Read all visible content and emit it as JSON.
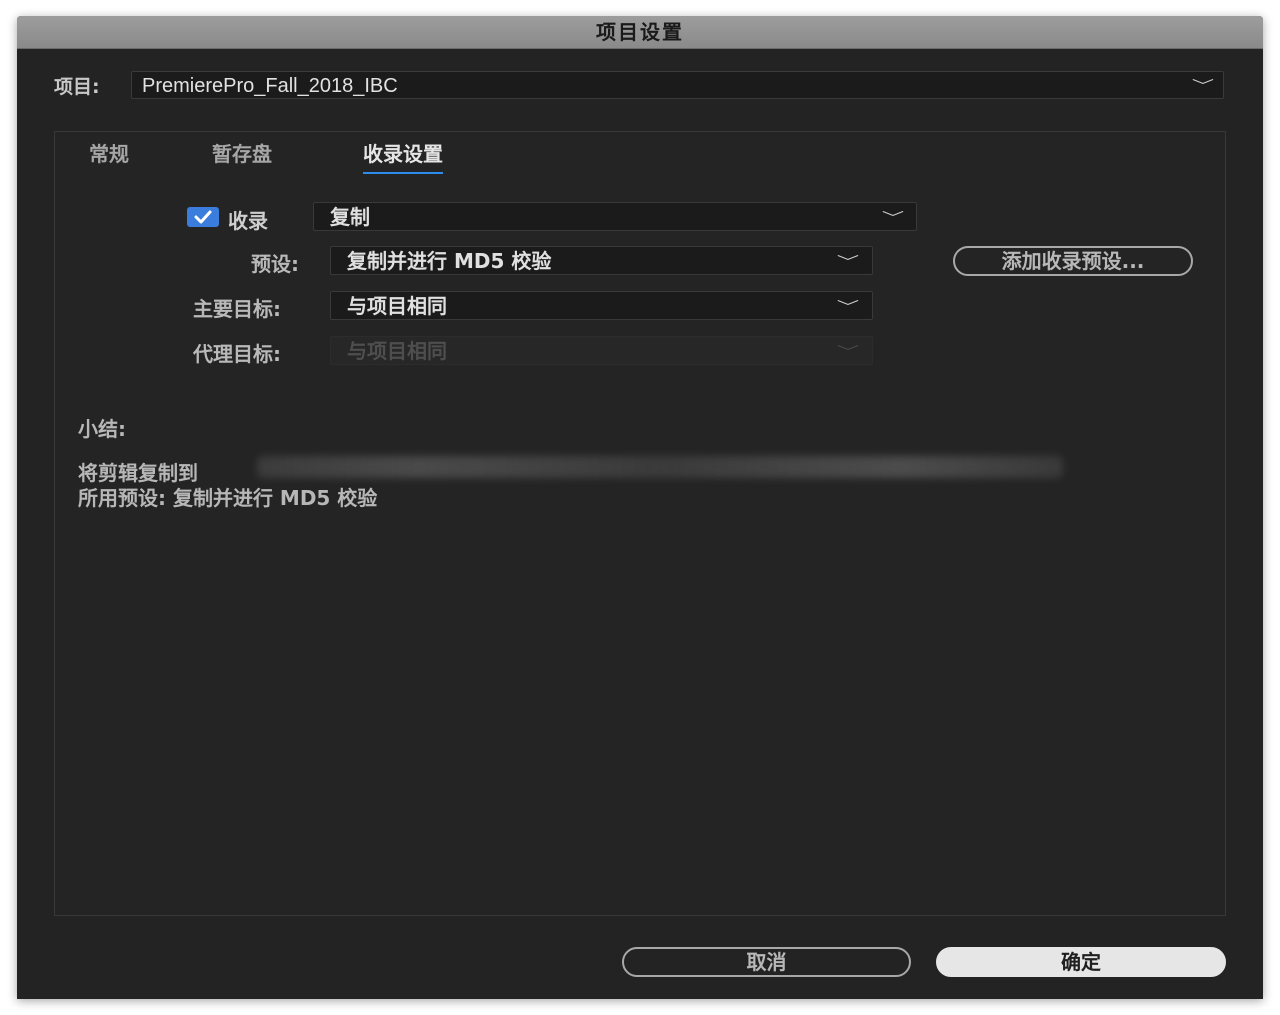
{
  "window": {
    "title": "项目设置"
  },
  "project": {
    "label": "项目:",
    "value": "PremierePro_Fall_2018_IBC"
  },
  "tabs": [
    {
      "label": "常规"
    },
    {
      "label": "暂存盘"
    },
    {
      "label": "收录设置",
      "active": true
    }
  ],
  "ingest": {
    "checkbox_label": "收录",
    "checked": true,
    "mode_value": "复制",
    "preset_label": "预设:",
    "preset_value": "复制并进行 MD5 校验",
    "add_preset_button": "添加收录预设...",
    "primary_label": "主要目标:",
    "primary_value": "与项目相同",
    "proxy_label": "代理目标:",
    "proxy_value": "与项目相同"
  },
  "summary": {
    "title": "小结:",
    "line1": "将剪辑复制到",
    "line2": "所用预设: 复制并进行 MD5 校验"
  },
  "footer": {
    "cancel": "取消",
    "ok": "确定"
  },
  "colors": {
    "accent": "#2d8ceb",
    "checkbox": "#3b7ddd",
    "background": "#232323",
    "titlebar": "#939393"
  }
}
